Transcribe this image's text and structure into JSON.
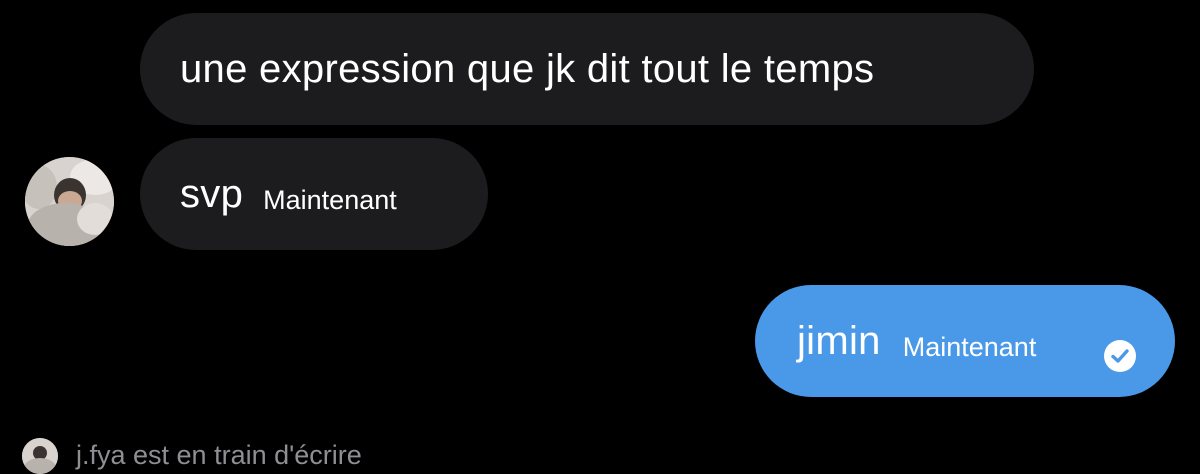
{
  "conversation": {
    "messages": [
      {
        "sender": "them",
        "text": "une expression que jk dit tout le temps"
      },
      {
        "sender": "them",
        "text": "svp",
        "time": "Maintenant"
      },
      {
        "sender": "me",
        "text": "jimin",
        "time": "Maintenant",
        "status_icon": "check-circle-icon"
      }
    ],
    "typing_indicator": "j.fya est en train d'écrire"
  },
  "colors": {
    "background": "#000000",
    "incoming_bubble": "#1c1c1e",
    "outgoing_bubble": "#4a99e9",
    "typing_text": "#8e8e93"
  }
}
